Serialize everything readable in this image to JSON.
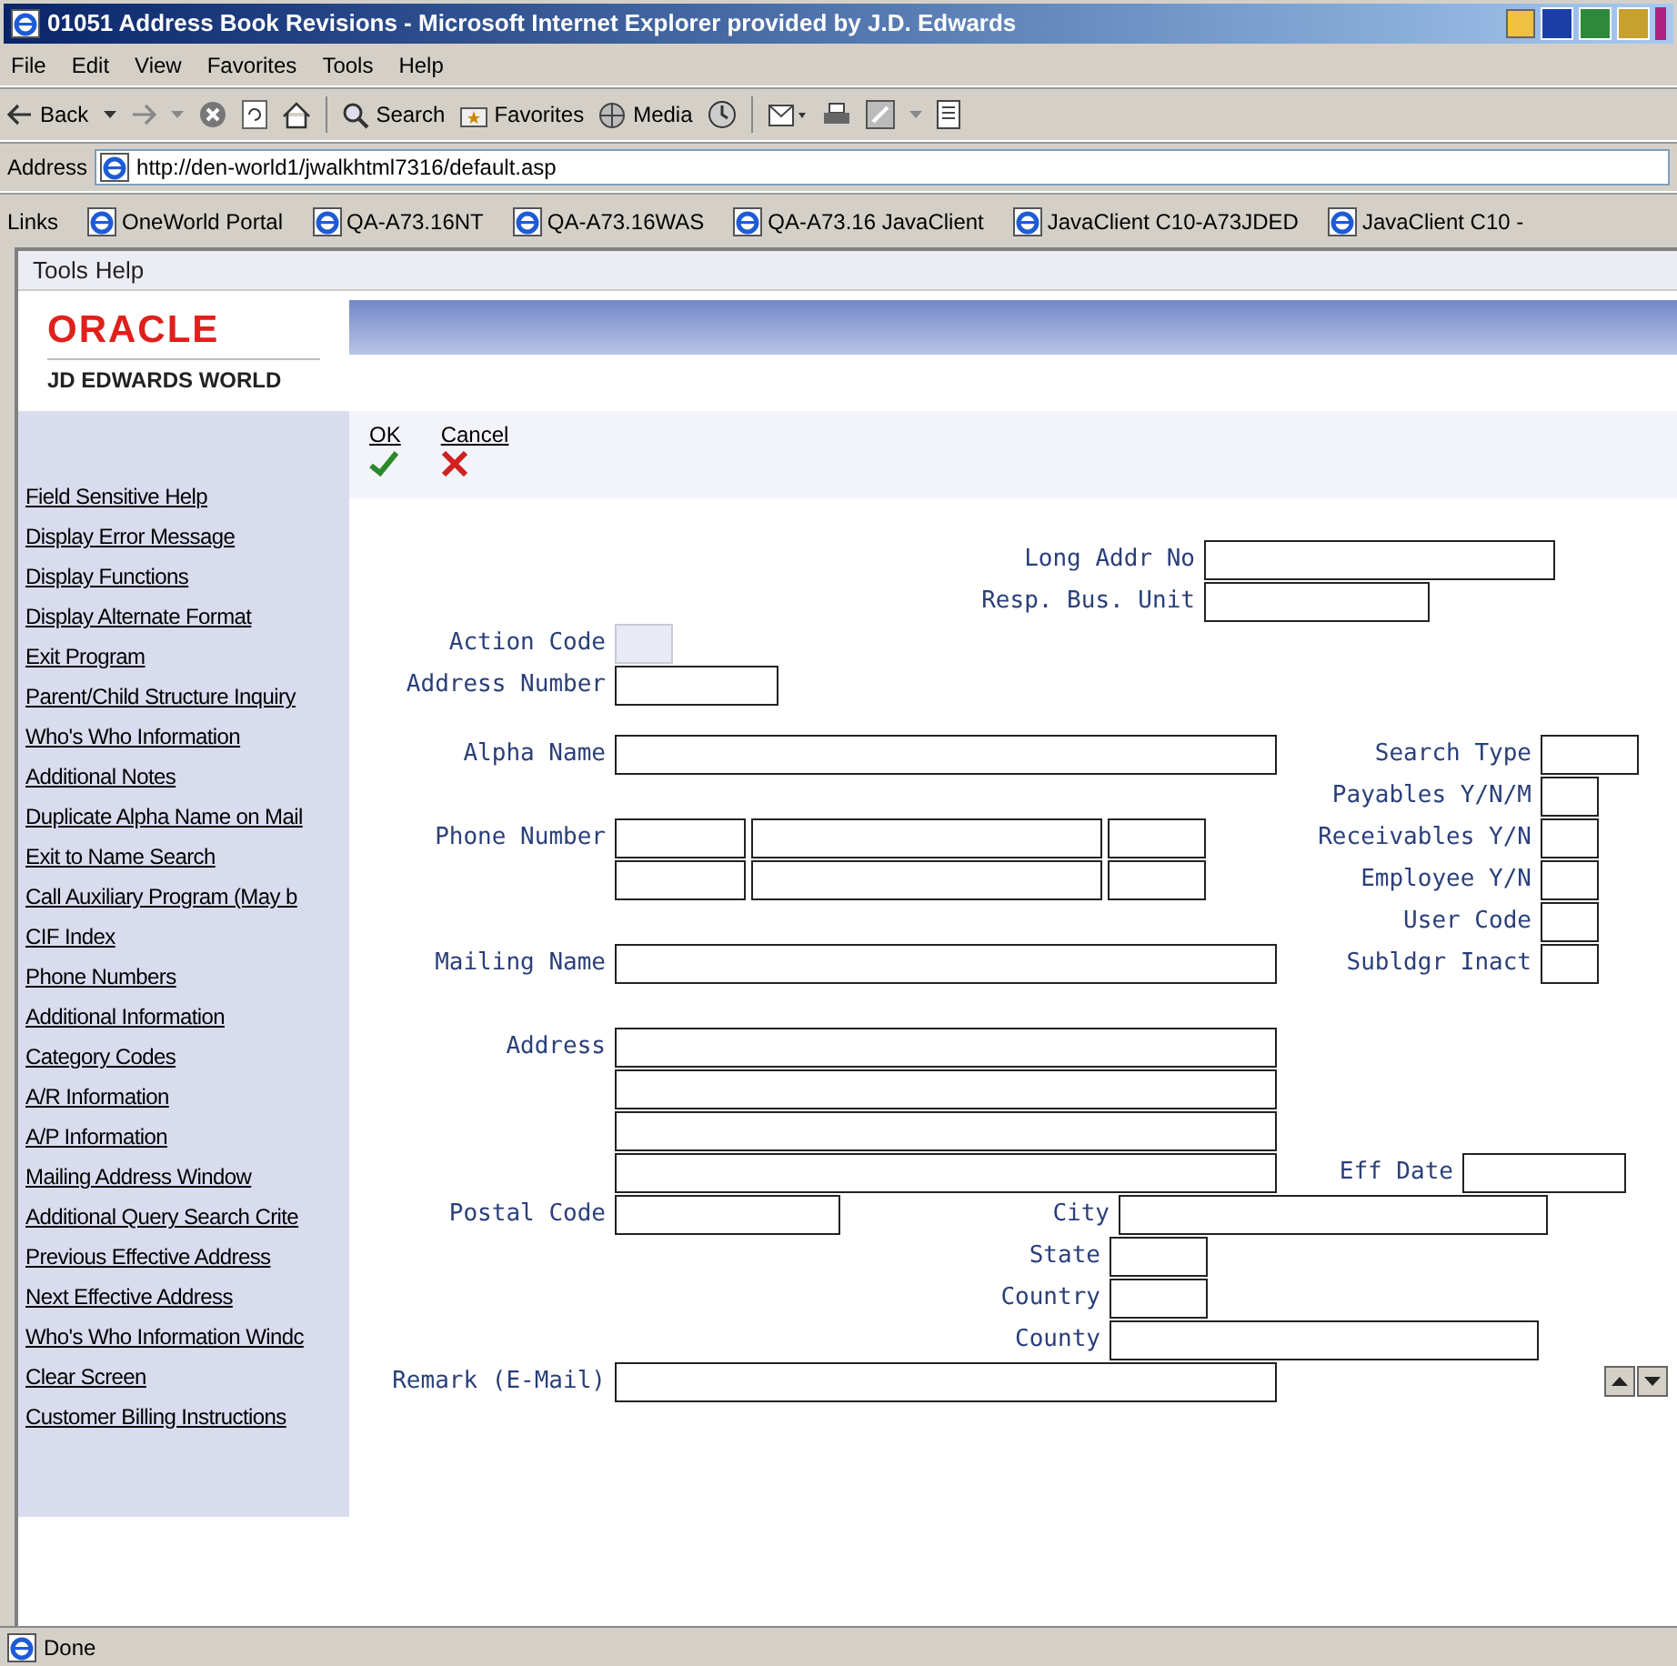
{
  "window": {
    "title": "01051 Address Book Revisions - Microsoft Internet Explorer provided by J.D. Edwards"
  },
  "menu": [
    "File",
    "Edit",
    "View",
    "Favorites",
    "Tools",
    "Help"
  ],
  "toolbar": {
    "back": "Back",
    "search": "Search",
    "favorites": "Favorites",
    "media": "Media"
  },
  "address_bar": {
    "label": "Address",
    "value": "http://den-world1/jwalkhtml7316/default.asp"
  },
  "links_bar": {
    "label": "Links",
    "items": [
      "OneWorld Portal",
      "QA-A73.16NT",
      "QA-A73.16WAS",
      "QA-A73.16 JavaClient",
      "JavaClient C10-A73JDED",
      "JavaClient C10 -"
    ]
  },
  "app_menu": [
    "Tools",
    "Help"
  ],
  "logo": {
    "brand": "ORACLE",
    "product": "JD EDWARDS WORLD"
  },
  "actions": [
    {
      "label": "OK",
      "kind": "ok"
    },
    {
      "label": "Cancel",
      "kind": "cancel"
    }
  ],
  "sidebar": {
    "items": [
      "Field Sensitive Help",
      "Display Error Message",
      "Display Functions",
      "Display Alternate Format",
      "Exit Program",
      "Parent/Child Structure Inquiry",
      "Who's Who Information",
      "Additional Notes",
      "Duplicate Alpha Name on Mail",
      "Exit to Name Search",
      "Call Auxiliary Program (May b",
      "CIF Index",
      "Phone Numbers",
      "Additional Information",
      "Category Codes",
      "A/R Information",
      "A/P Information",
      "Mailing Address Window",
      "Additional Query Search Crite",
      "Previous Effective Address",
      "Next Effective Address",
      "Who's Who Information Windc",
      "Clear Screen",
      "Customer Billing Instructions"
    ]
  },
  "form": {
    "long_addr_no": {
      "label": "Long Addr No"
    },
    "resp_bus_unit": {
      "label": "Resp. Bus. Unit"
    },
    "action_code": {
      "label": "Action Code",
      "disabled": true
    },
    "address_number": {
      "label": "Address Number"
    },
    "alpha_name": {
      "label": "Alpha Name"
    },
    "search_type": {
      "label": "Search Type"
    },
    "payables": {
      "label": "Payables Y/N/M"
    },
    "phone_number": {
      "label": "Phone Number"
    },
    "receivables": {
      "label": "Receivables Y/N"
    },
    "employee": {
      "label": "Employee Y/N"
    },
    "user_code": {
      "label": "User Code"
    },
    "mailing_name": {
      "label": "Mailing Name"
    },
    "subldgr_inact": {
      "label": "Subldgr Inact"
    },
    "address": {
      "label": "Address"
    },
    "eff_date": {
      "label": "Eff Date"
    },
    "postal_code": {
      "label": "Postal Code"
    },
    "city": {
      "label": "City"
    },
    "state": {
      "label": "State"
    },
    "country": {
      "label": "Country"
    },
    "county": {
      "label": "County"
    },
    "remark": {
      "label": "Remark (E-Mail)"
    }
  },
  "status_bar": {
    "text": "Done"
  }
}
